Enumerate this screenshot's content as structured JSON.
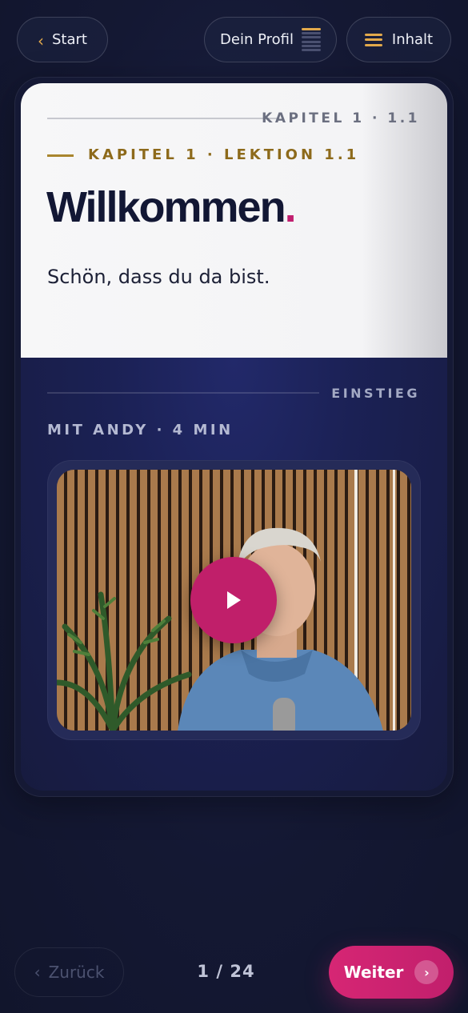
{
  "header": {
    "start_label": "Start",
    "profile_label": "Dein Profil",
    "toc_label": "Inhalt"
  },
  "lesson": {
    "meta_tag": "KAPITEL 1 · 1.1",
    "kicker": "KAPITEL 1 · LEKTION 1.1",
    "title": "Willkommen",
    "title_punct": ".",
    "subtitle": "Schön, dass du da bist."
  },
  "section": {
    "tag": "EINSTIEG",
    "video_meta": "MIT ANDY · 4 MIN"
  },
  "footer": {
    "back_label": "Zurück",
    "page_indicator": "1 / 24",
    "next_label": "Weiter"
  },
  "colors": {
    "accent": "#c11f6f",
    "gold": "#e2a94b",
    "background": "#141833"
  },
  "icons": [
    "chevron-left-icon",
    "progress-icon",
    "hamburger-icon",
    "play-icon",
    "chevron-right-icon"
  ]
}
